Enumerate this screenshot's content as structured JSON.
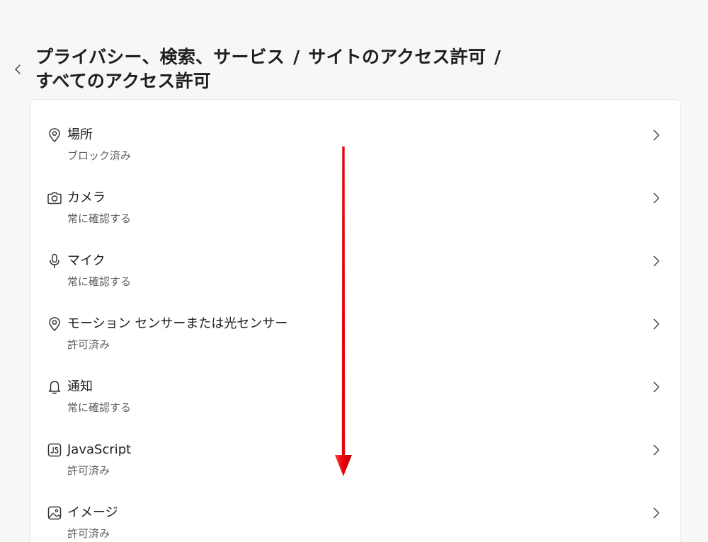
{
  "header": {
    "breadcrumb": [
      {
        "label": "プライバシー、検索、サービス"
      },
      {
        "label": "サイトのアクセス許可"
      },
      {
        "label": "すべてのアクセス許可"
      }
    ],
    "separator": "/",
    "back_icon": "chevron-left-icon"
  },
  "permissions": [
    {
      "label": "場所",
      "status": "ブロック済み",
      "icon": "location-pin-icon"
    },
    {
      "label": "カメラ",
      "status": "常に確認する",
      "icon": "camera-icon"
    },
    {
      "label": "マイク",
      "status": "常に確認する",
      "icon": "microphone-icon"
    },
    {
      "label": "モーション センサーまたは光センサー",
      "status": "許可済み",
      "icon": "motion-sensor-icon"
    },
    {
      "label": "通知",
      "status": "常に確認する",
      "icon": "bell-icon"
    },
    {
      "label": "JavaScript",
      "status": "許可済み",
      "icon": "javascript-icon"
    },
    {
      "label": "イメージ",
      "status": "許可済み",
      "icon": "image-icon"
    }
  ],
  "colors": {
    "background": "#f7f7f7",
    "card": "#ffffff",
    "annotation_arrow": "#e8000b"
  }
}
